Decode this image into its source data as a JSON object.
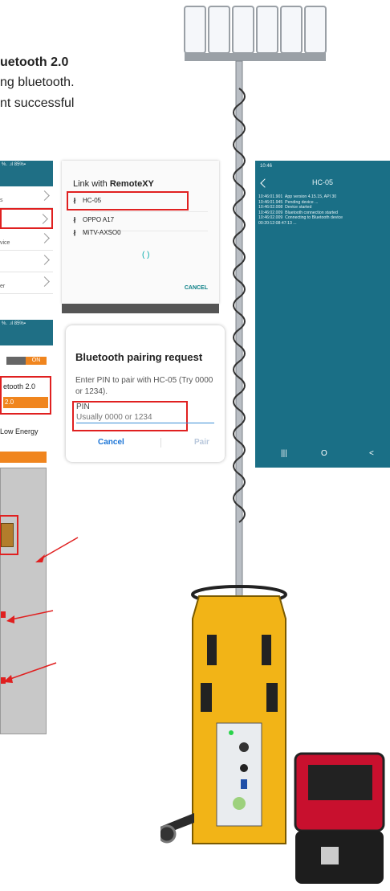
{
  "header": {
    "title": "uetooth 2.0",
    "line1": "ng bluetooth.",
    "line2": "nt successful"
  },
  "left_panel_top": {
    "status": "%.  .ıl 85%▪",
    "rows": [
      "s",
      "",
      "vice",
      "",
      "er"
    ]
  },
  "left_panel_bottom": {
    "status": "%.  .ıl 85%▪",
    "toggle": "ON",
    "item1": "etooth 2.0",
    "item1_button": "2.0",
    "item2": "Low Energy"
  },
  "link_dialog": {
    "title_prefix": "Link with ",
    "title_app": "RemoteXY",
    "devices": [
      "HC-05",
      "OPPO A17",
      "MiTV-AXSO0"
    ],
    "spinner": "(   )",
    "cancel": "CANCEL"
  },
  "pairing_dialog": {
    "title": "Bluetooth pairing request",
    "description": "Enter PIN to pair with HC-05 (Try 0000 or 1234).",
    "pin_label": "PIN",
    "pin_placeholder": "Usually 0000 or 1234",
    "cancel": "Cancel",
    "pair": "Pair"
  },
  "terminal": {
    "time": "10:46",
    "device": "HC-05",
    "log": [
      "10:46:01.901  App version 4.15.15, API 30",
      "10:46:01.945  Pending device ...",
      "10:46:02.008  Device started",
      "10:46:02.009  Bluetooth connection started",
      "10:46:02.009  Connecting to Bluetooth device",
      "00:20:12:08:47:13 ..."
    ],
    "nav_recent": "|||",
    "nav_home": "O",
    "nav_back": "<"
  },
  "colors": {
    "teal": "#1a6f86",
    "orange": "#f0851e",
    "highlight": "#e02020",
    "tower_yellow": "#f2b417"
  }
}
